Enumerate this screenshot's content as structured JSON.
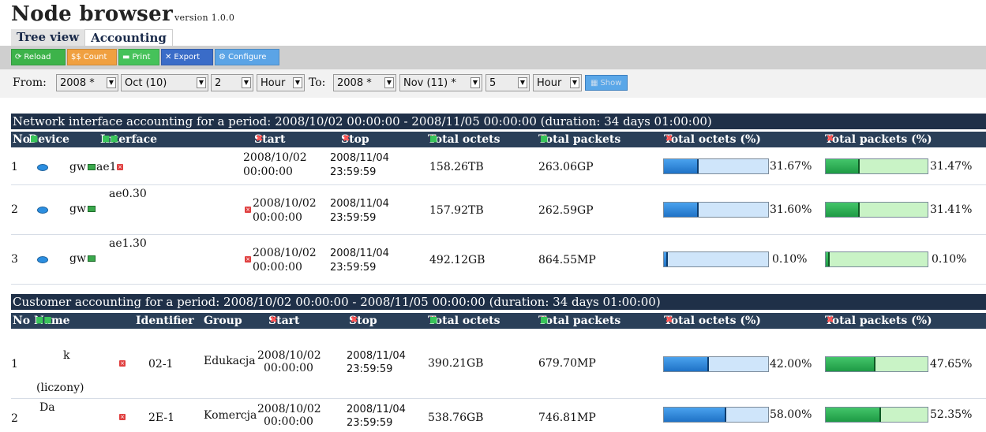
{
  "app": {
    "title": "Node browser",
    "version": "version 1.0.0"
  },
  "tabs": [
    {
      "label": "Tree view"
    },
    {
      "label": "Accounting"
    }
  ],
  "toolbar": {
    "reload": "Reload",
    "count": "Count",
    "print": "Print",
    "export": "Export",
    "configure": "Configure"
  },
  "filters": {
    "from_label": "From:",
    "to_label": "To:",
    "from_year": "2008 *",
    "from_month": "Oct (10)",
    "from_day": "2",
    "from_unit": "Hour",
    "to_year": "2008 *",
    "to_month": "Nov (11) *",
    "to_day": "5",
    "to_unit": "Hour",
    "show_label": "Show"
  },
  "network": {
    "title": "Network interface accounting for a period: 2008/10/02 00:00:00 - 2008/11/05 00:00:00 (duration: 34 days 01:00:00)",
    "headers": {
      "no": "No",
      "device": "Device",
      "interface": "Interface",
      "start": "Start",
      "stop": "Stop",
      "total_octets": "Total octets",
      "total_packets": "Total packets",
      "octets_pct": "Total octets (%)",
      "packets_pct": "Total packets (%)"
    },
    "rows": [
      {
        "no": "1",
        "device": "gw",
        "interface": "ae1",
        "start_date": "2008/10/02",
        "start_time": "00:00:00",
        "stop_date": "2008/11/04",
        "stop_time": "23:59:59",
        "octets": "158.26TB",
        "packets": "263.06GP",
        "octets_pct": "31.67%",
        "packets_pct": "31.47%",
        "octets_frac": 0.3167,
        "packets_frac": 0.3147
      },
      {
        "no": "2",
        "device": "gw",
        "interface": "ae0.30",
        "start_date": "2008/10/02",
        "start_time": "00:00:00",
        "stop_date": "2008/11/04",
        "stop_time": "23:59:59",
        "octets": "157.92TB",
        "packets": "262.59GP",
        "octets_pct": "31.60%",
        "packets_pct": "31.41%",
        "octets_frac": 0.316,
        "packets_frac": 0.3141
      },
      {
        "no": "3",
        "device": "gw",
        "interface": "ae1.30",
        "start_date": "2008/10/02",
        "start_time": "00:00:00",
        "stop_date": "2008/11/04",
        "stop_time": "23:59:59",
        "octets": "492.12GB",
        "packets": "864.55MP",
        "octets_pct": "0.10%",
        "packets_pct": "0.10%",
        "octets_frac": 0.001,
        "packets_frac": 0.001
      }
    ]
  },
  "customer": {
    "title": "Customer accounting for a period: 2008/10/02 00:00:00 - 2008/11/05 00:00:00 (duration: 34 days 01:00:00)",
    "headers": {
      "no": "No",
      "name": "Name",
      "identifier": "Identifier",
      "group": "Group",
      "start": "Start",
      "stop": "Stop",
      "total_octets": "Total octets",
      "total_packets": "Total packets",
      "octets_pct": "Total octets (%)",
      "packets_pct": "Total packets (%)"
    },
    "rows": [
      {
        "no": "1",
        "name": "k",
        "name_sub": "(liczony)",
        "identifier": "02-1",
        "group": "Edukacja",
        "start_date": "2008/10/02",
        "start_time": "00:00:00",
        "stop_date": "2008/11/04",
        "stop_time": "23:59:59",
        "octets": "390.21GB",
        "packets": "679.70MP",
        "octets_pct": "42.00%",
        "packets_pct": "47.65%",
        "octets_frac": 0.42,
        "packets_frac": 0.4765
      },
      {
        "no": "2",
        "name": "Da",
        "name_sub": "",
        "identifier": "2E-1",
        "group": "Komercja",
        "start_date": "2008/10/02",
        "start_time": "00:00:00",
        "stop_date": "2008/11/04",
        "stop_time": "23:59:59",
        "octets": "538.76GB",
        "packets": "746.81MP",
        "octets_pct": "58.00%",
        "packets_pct": "52.35%",
        "octets_frac": 0.58,
        "packets_frac": 0.5235
      }
    ]
  },
  "colors": {
    "header_bg": "#1f3048",
    "bar_blue": "#1f72c6",
    "bar_green": "#1e9a45"
  },
  "icons": [
    "reload-icon",
    "count-icon",
    "print-icon",
    "export-icon",
    "configure-icon",
    "show-icon",
    "sort-remove-icon",
    "sort-toggle-icon",
    "device-icon",
    "graph-icon"
  ]
}
